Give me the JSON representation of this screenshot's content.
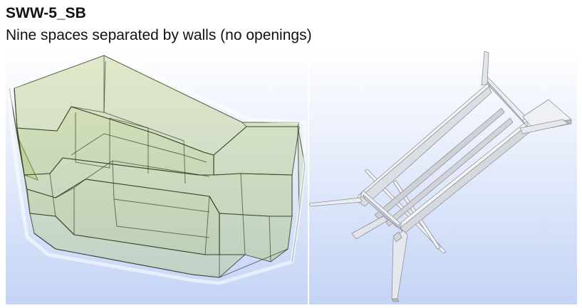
{
  "title": "SWW-5_SB",
  "subtitle": "Nine spaces separated by walls (no openings)",
  "colors": {
    "viewport_sky_top": "#ffffff",
    "viewport_sky_bottom": "#c4d4f6",
    "space_fill": "#a8bf5a",
    "space_edge": "#2d3a1c",
    "wall_light": "#f4f5f7",
    "wall_mid": "#d9dbe0",
    "wall_dark": "#a9acb4"
  }
}
